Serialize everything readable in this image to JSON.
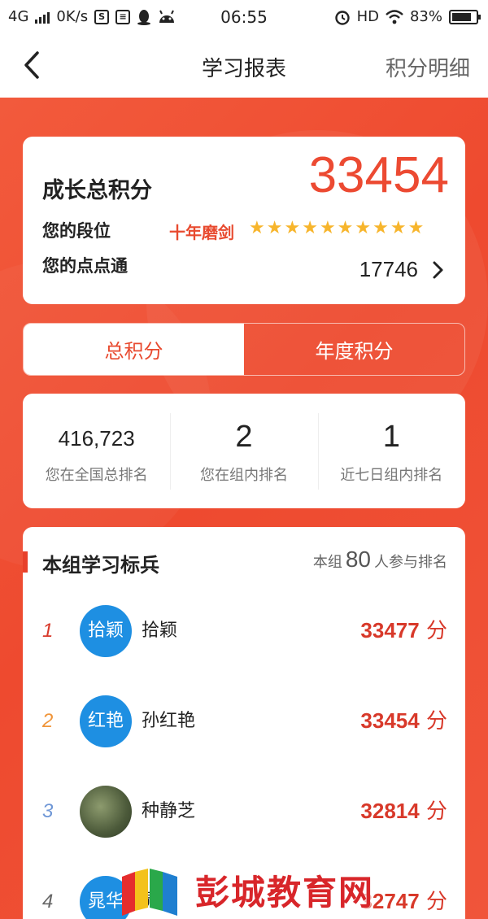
{
  "status_bar": {
    "network": "4G",
    "speed": "0K/s",
    "time": "06:55",
    "hd": "HD",
    "battery": "83%",
    "battery_level": 0.83
  },
  "nav": {
    "title": "学习报表",
    "detail_link": "积分明细"
  },
  "growth": {
    "total_label": "成长总积分",
    "total_score": "33454",
    "rank_label": "您的段位",
    "rank_title": "十年磨剑",
    "stars": 10,
    "diandiantong_label": "您的点点通",
    "diandiantong_value": "17746"
  },
  "tabs": [
    {
      "label": "总积分",
      "active": true
    },
    {
      "label": "年度积分",
      "active": false
    }
  ],
  "stats": [
    {
      "value": "416,723",
      "caption": "您在全国总排名"
    },
    {
      "value": "2",
      "caption": "您在组内排名"
    },
    {
      "value": "1",
      "caption": "近七日组内排名"
    }
  ],
  "group": {
    "title": "本组学习标兵",
    "meta_prefix": "本组",
    "meta_count": "80",
    "meta_suffix": "人参与排名",
    "rows": [
      {
        "rank": "1",
        "avatar_text": "拾颖",
        "name": "拾颖",
        "points": "33477",
        "unit": "分",
        "rank_color": "#d8392a"
      },
      {
        "rank": "2",
        "avatar_text": "红艳",
        "name": "孙红艳",
        "points": "33454",
        "unit": "分",
        "rank_color": "#f0953a"
      },
      {
        "rank": "3",
        "avatar_text": "",
        "name": "种静芝",
        "points": "32814",
        "unit": "分",
        "rank_color": "#6f97d6"
      },
      {
        "rank": "4",
        "avatar_text": "晁华",
        "name": "晁华",
        "points": "32747",
        "unit": "分",
        "rank_color": "#666666"
      }
    ]
  },
  "watermark": {
    "text": "彭城教育网"
  },
  "colors": {
    "accent": "#ec4a32",
    "avatar_blue": "#1e8fe2",
    "star": "#f7b52c"
  }
}
